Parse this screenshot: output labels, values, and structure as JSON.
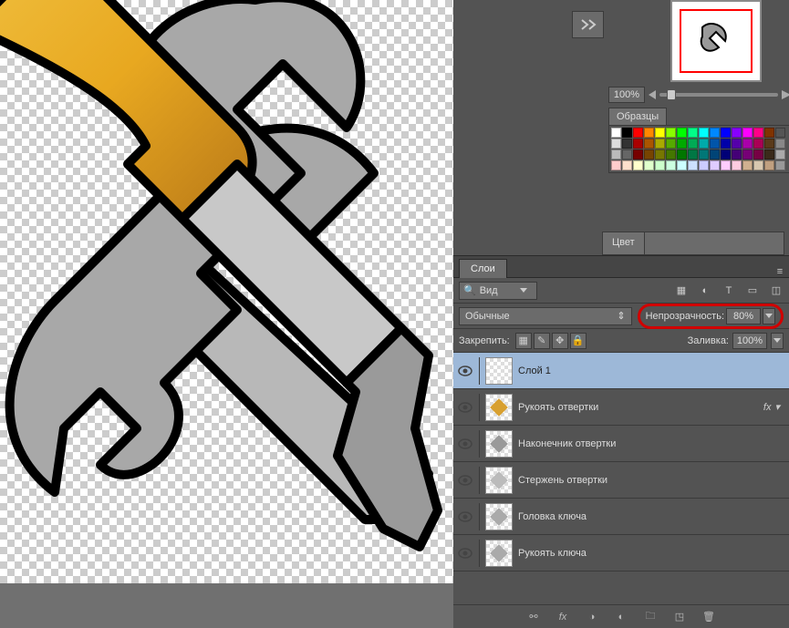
{
  "navigator": {
    "zoom": "100%"
  },
  "swatches": {
    "tab": "Образцы",
    "colors": [
      "#ffffff",
      "#000000",
      "#ff0000",
      "#ff8800",
      "#ffff00",
      "#88ff00",
      "#00ff00",
      "#00ff88",
      "#00ffff",
      "#0088ff",
      "#0000ff",
      "#8800ff",
      "#ff00ff",
      "#ff0088",
      "#803300",
      "#555555",
      "#dddddd",
      "#333333",
      "#aa0000",
      "#aa5500",
      "#aaaa00",
      "#55aa00",
      "#00aa00",
      "#00aa55",
      "#00aaaa",
      "#0055aa",
      "#0000aa",
      "#5500aa",
      "#aa00aa",
      "#aa0055",
      "#5a3a1a",
      "#888888",
      "#bbbbbb",
      "#666666",
      "#770000",
      "#774400",
      "#777700",
      "#447700",
      "#007700",
      "#007744",
      "#007777",
      "#004477",
      "#000077",
      "#440077",
      "#770077",
      "#770044",
      "#3a2a1a",
      "#aaaaaa",
      "#ffcccc",
      "#ffe0cc",
      "#ffffcc",
      "#e0ffcc",
      "#ccffcc",
      "#ccffe0",
      "#ccffff",
      "#cce0ff",
      "#ccccff",
      "#e0ccff",
      "#ffccff",
      "#ffcce0",
      "#d0b090",
      "#d8c8b0",
      "#c0a080",
      "#999999"
    ]
  },
  "color_panel": {
    "tab": "Цвет"
  },
  "layers_panel": {
    "tab": "Слои",
    "search_label": "Вид",
    "blend_mode": "Обычные",
    "opacity_label": "Непрозрачность:",
    "opacity_value": "80%",
    "lock_label": "Закрепить:",
    "fill_label": "Заливка:",
    "fill_value": "100%",
    "layers": [
      {
        "name": "Слой 1",
        "selected": true,
        "fx": false,
        "thumb": ""
      },
      {
        "name": "Рукоять отвертки",
        "selected": false,
        "fx": true,
        "thumb": "#d8a030"
      },
      {
        "name": "Наконечник отвертки",
        "selected": false,
        "fx": false,
        "thumb": "#999"
      },
      {
        "name": "Стержень отвертки",
        "selected": false,
        "fx": false,
        "thumb": "#bbb"
      },
      {
        "name": "Головка ключа",
        "selected": false,
        "fx": false,
        "thumb": "#aaa"
      },
      {
        "name": "Рукоять ключа",
        "selected": false,
        "fx": false,
        "thumb": "#aaa"
      }
    ]
  }
}
